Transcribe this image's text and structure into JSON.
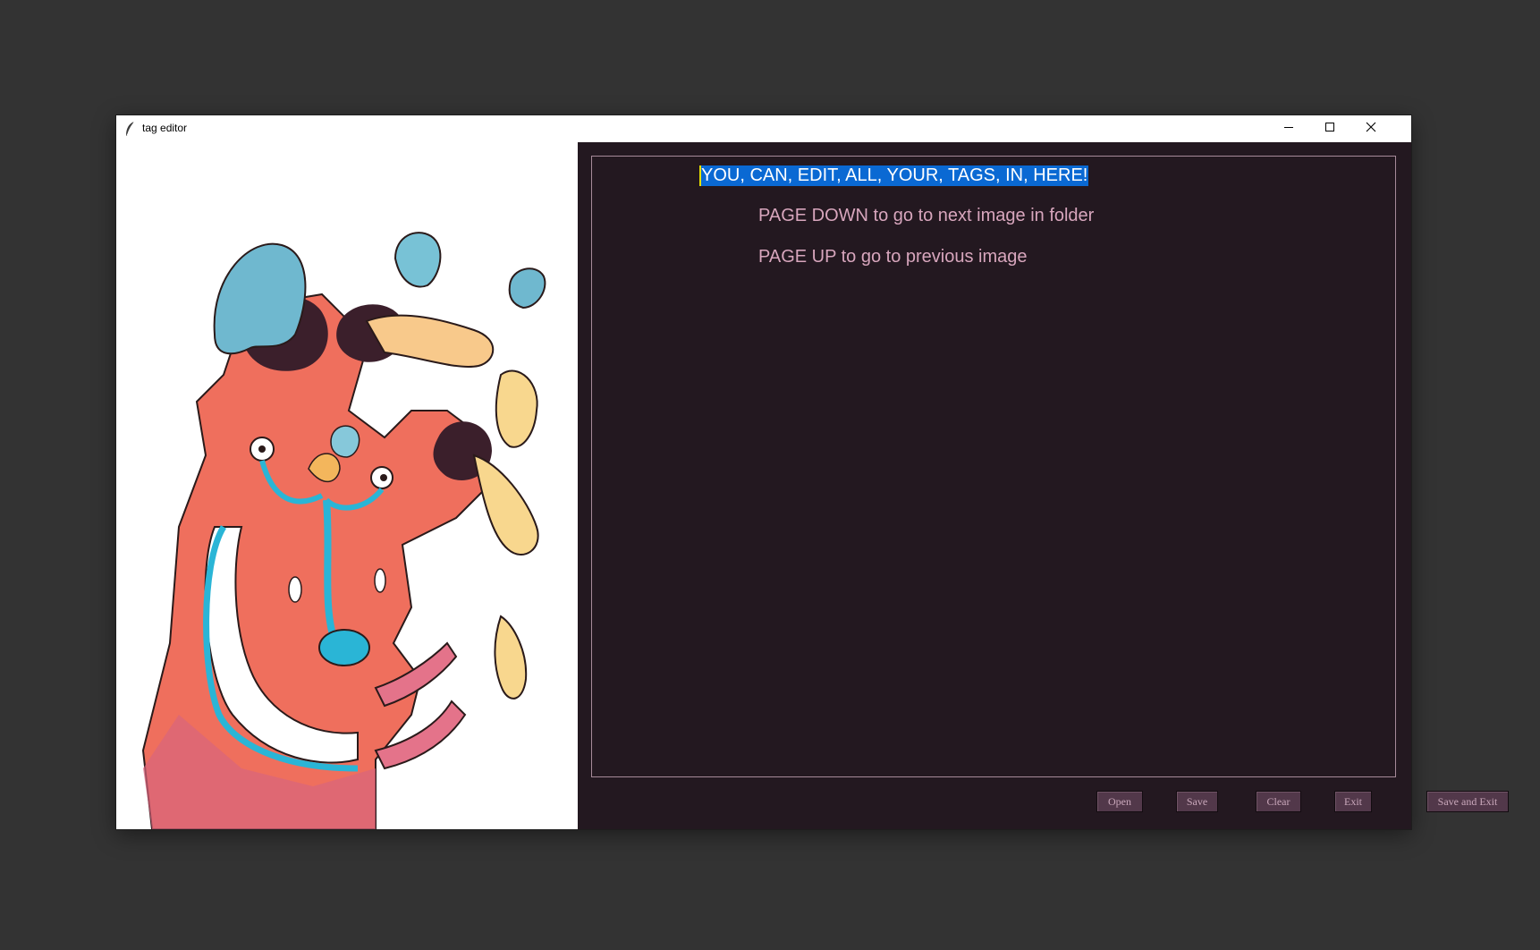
{
  "window": {
    "title": "tag editor",
    "controls": [
      "minimize-icon",
      "maximize-icon",
      "close-icon"
    ]
  },
  "image_pane": {
    "alt": "colorful monster illustration"
  },
  "editor": {
    "lines": [
      "YOU, CAN, EDIT, ALL, YOUR, TAGS, IN, HERE!",
      "PAGE DOWN to go to next image in folder",
      "PAGE UP to go to previous image"
    ],
    "selection_color": "#0a69d3",
    "text_color": "#d8a6bd",
    "background": "#231820"
  },
  "buttons": {
    "open": "Open",
    "save": "Save",
    "clear": "Clear",
    "exit": "Exit",
    "save_and_exit": "Save and Exit"
  },
  "colors": {
    "desktop": "#333333",
    "button_bg": "#52384a",
    "button_text": "#caa8bb"
  }
}
